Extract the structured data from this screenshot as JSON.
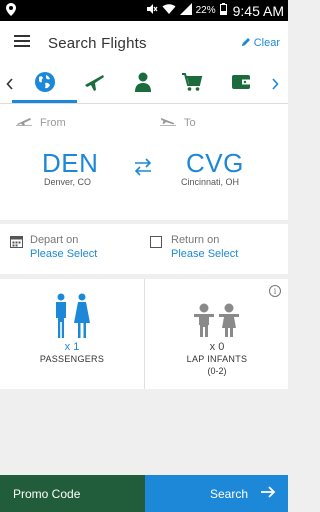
{
  "status_bar": {
    "battery_percent": "22%",
    "time": "9:45 AM"
  },
  "header": {
    "title": "Search Flights",
    "clear_label": "Clear"
  },
  "tabs": {
    "active_index": 0,
    "items": [
      {
        "icon": "globe-icon"
      },
      {
        "icon": "airplane-icon"
      },
      {
        "icon": "person-icon"
      },
      {
        "icon": "cart-icon"
      },
      {
        "icon": "wallet-icon"
      }
    ]
  },
  "route": {
    "from_label": "From",
    "to_label": "To",
    "origin": {
      "code": "DEN",
      "city": "Denver, CO"
    },
    "destination": {
      "code": "CVG",
      "city": "Cincinnati, OH"
    }
  },
  "dates": {
    "depart_label": "Depart on",
    "depart_value": "Please Select",
    "return_label": "Return on",
    "return_value": "Please Select"
  },
  "passengers": {
    "adults_count": "x 1",
    "adults_label": "PASSENGERS",
    "infants_count": "x 0",
    "infants_label": "LAP INFANTS",
    "infants_sub": "(0-2)"
  },
  "footer": {
    "promo_label": "Promo Code",
    "search_label": "Search"
  },
  "colors": {
    "accent": "#1e88d8",
    "promo_bg": "#215d3a",
    "icon_green": "#1b6b3d"
  }
}
